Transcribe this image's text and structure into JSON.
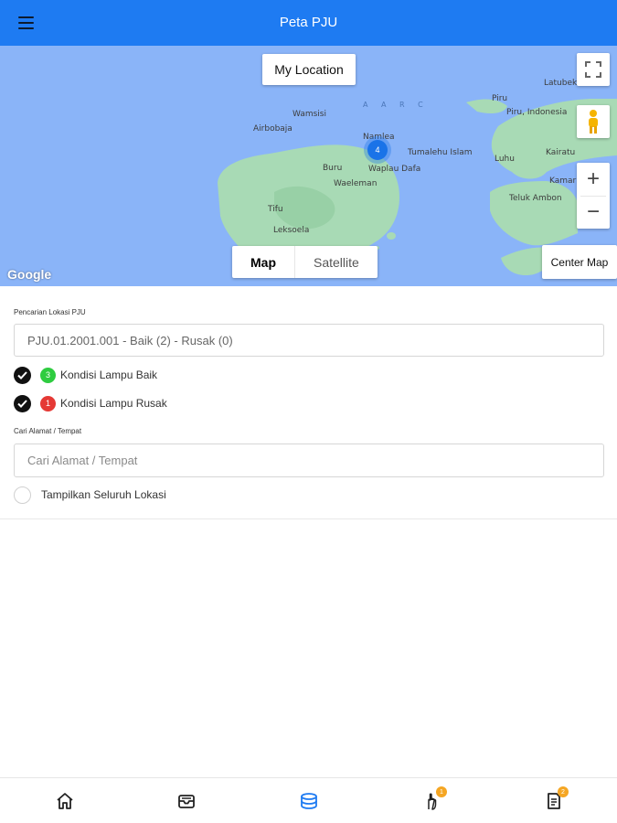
{
  "app_bar": {
    "title": "Peta PJU",
    "menu_icon": "hamburger-menu-icon"
  },
  "map": {
    "my_location_label": "My Location",
    "center_map_label": "Center Map",
    "map_type_options": [
      "Map",
      "Satellite"
    ],
    "map_type_selected": "Map",
    "attribution": "Google",
    "cluster_count": "4",
    "zoom_in_label": "+",
    "zoom_out_label": "−",
    "water_colour": "#8ab4f8",
    "land_colour": "#a8dab5",
    "place_labels": {
      "wamsisi": "Wamsisi",
      "airbobaja": "Airbobaja",
      "namlea": "Namlea",
      "tumalehu_islam": "Tumalehu Islam",
      "waplau_dafa": "Waplau Dafa",
      "buru": "Buru",
      "waeleman": "Waeleman",
      "tifu": "Tifu",
      "leksoela": "Leksoela",
      "piru": "Piru",
      "piru_indonesia": "Piru, Indonesia",
      "latubeka": "Latubeka",
      "kairatu": "Kairatu",
      "luhu": "Luhu",
      "kamariang": "Kamariang",
      "teluk_ambon": "Teluk Ambon",
      "water_text": "A A R C"
    }
  },
  "form": {
    "search_pju_label": "Pencarian Lokasi PJU",
    "search_pju_value": "PJU.01.2001.001 - Baik (2) - Rusak (0)",
    "conditions": [
      {
        "count": "3",
        "label": "Kondisi Lampu Baik",
        "colour": "#2ecc40"
      },
      {
        "count": "1",
        "label": "Kondisi Lampu Rusak",
        "colour": "#e53935"
      }
    ],
    "address_label": "Cari Alamat / Tempat",
    "address_placeholder": "Cari Alamat / Tempat",
    "show_all_label": "Tampilkan Seluruh Lokasi"
  },
  "bottom_nav": {
    "items": [
      {
        "icon": "home-icon",
        "badge": ""
      },
      {
        "icon": "inbox-icon",
        "badge": ""
      },
      {
        "icon": "layers-icon",
        "badge": ""
      },
      {
        "icon": "report-hand-icon",
        "badge": "1"
      },
      {
        "icon": "document-list-icon",
        "badge": "2"
      }
    ],
    "active_colour": "#1e7bf2",
    "badge_colour": "#f5a623"
  }
}
